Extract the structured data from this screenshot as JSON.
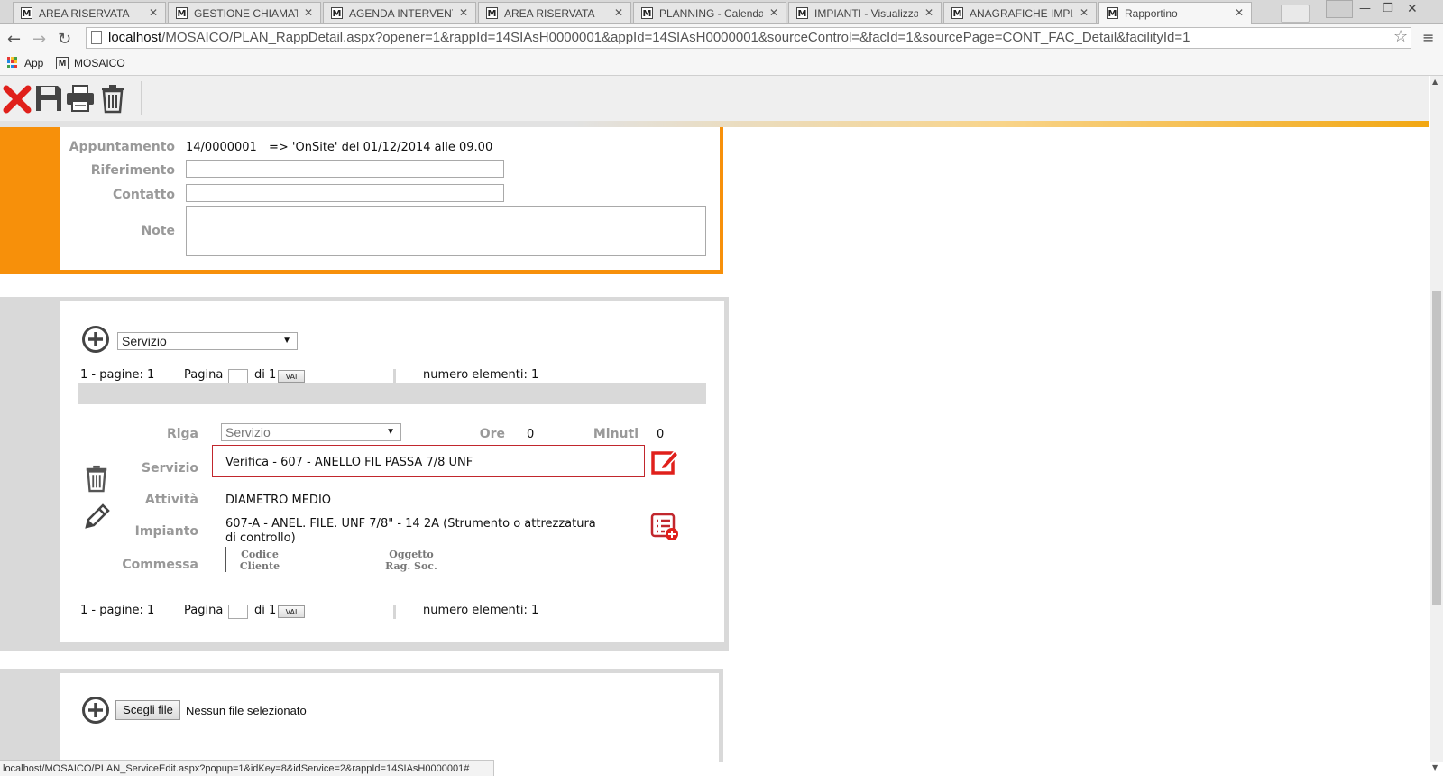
{
  "browser": {
    "tabs": [
      {
        "label": "AREA RISERVATA",
        "active": false
      },
      {
        "label": "GESTIONE CHIAMATE",
        "active": false
      },
      {
        "label": "AGENDA INTERVENTI",
        "active": false
      },
      {
        "label": "AREA RISERVATA",
        "active": false
      },
      {
        "label": "PLANNING - Calendari",
        "active": false
      },
      {
        "label": "IMPIANTI - Visualizzazi",
        "active": false
      },
      {
        "label": "ANAGRAFICHE IMPIAN",
        "active": false
      },
      {
        "label": "Rapportino",
        "active": true
      }
    ],
    "favicon_letter": "M",
    "url_host": "localhost",
    "url_path": "/MOSAICO/PLAN_RappDetail.aspx?opener=1&rappId=14SIAsH0000001&appId=14SIAsH0000001&sourceControl=&facId=1&sourcePage=CONT_FAC_Detail&facilityId=1",
    "bookmarks": [
      {
        "label": "App",
        "icon": "apps-grid-icon"
      },
      {
        "label": "MOSAICO",
        "icon": "mosaico-favicon"
      }
    ],
    "status_url": "localhost/MOSAICO/PLAN_ServiceEdit.aspx?popup=1&idKey=8&idService=2&rappId=14SIAsH0000001#"
  },
  "toolbar": {
    "icons": [
      "close-icon",
      "save-icon",
      "print-icon",
      "trash-icon"
    ]
  },
  "appointment": {
    "appuntamento_label": "Appuntamento",
    "appuntamento_link": "14/0000001",
    "appuntamento_text": "=> 'OnSite' del 01/12/2014 alle 09.00",
    "riferimento_label": "Riferimento",
    "riferimento_value": "",
    "contatto_label": "Contatto",
    "contatto_value": "",
    "note_label": "Note",
    "note_value": "",
    "accent_color": "#f7900a"
  },
  "services": {
    "type_select": "Servizio",
    "pager_top": {
      "summary": "1 - pagine: 1",
      "pagina_label": "Pagina",
      "di_label": "di 1",
      "vai_label": "VAI",
      "count_label": "numero elementi: 1"
    },
    "row": {
      "riga_label": "Riga",
      "riga_select": "Servizio",
      "ore_label": "Ore",
      "ore_value": "0",
      "minuti_label": "Minuti",
      "minuti_value": "0",
      "servizio_label": "Servizio",
      "servizio_value": "Verifica - 607 - ANELLO FIL PASSA 7/8 UNF",
      "attivita_label": "Attività",
      "attivita_value": "DIAMETRO MEDIO",
      "impianto_label": "Impianto",
      "impianto_value_1": "607-A - ANEL. FILE. UNF 7/8\" - 14 2A (Strumento o attrezzatura",
      "impianto_value_2": "di controllo)",
      "commessa_label": "Commessa",
      "codice_label": "Codice",
      "cliente_label": "Cliente",
      "oggetto_label": "Oggetto",
      "ragsoc_label": "Rag. Soc."
    },
    "pager_bottom": {
      "summary": "1 - pagine: 1",
      "pagina_label": "Pagina",
      "di_label": "di 1",
      "vai_label": "VAI",
      "count_label": "numero elementi: 1"
    }
  },
  "attachments": {
    "choose_button": "Scegli file",
    "no_file_text": "Nessun file selezionato"
  }
}
